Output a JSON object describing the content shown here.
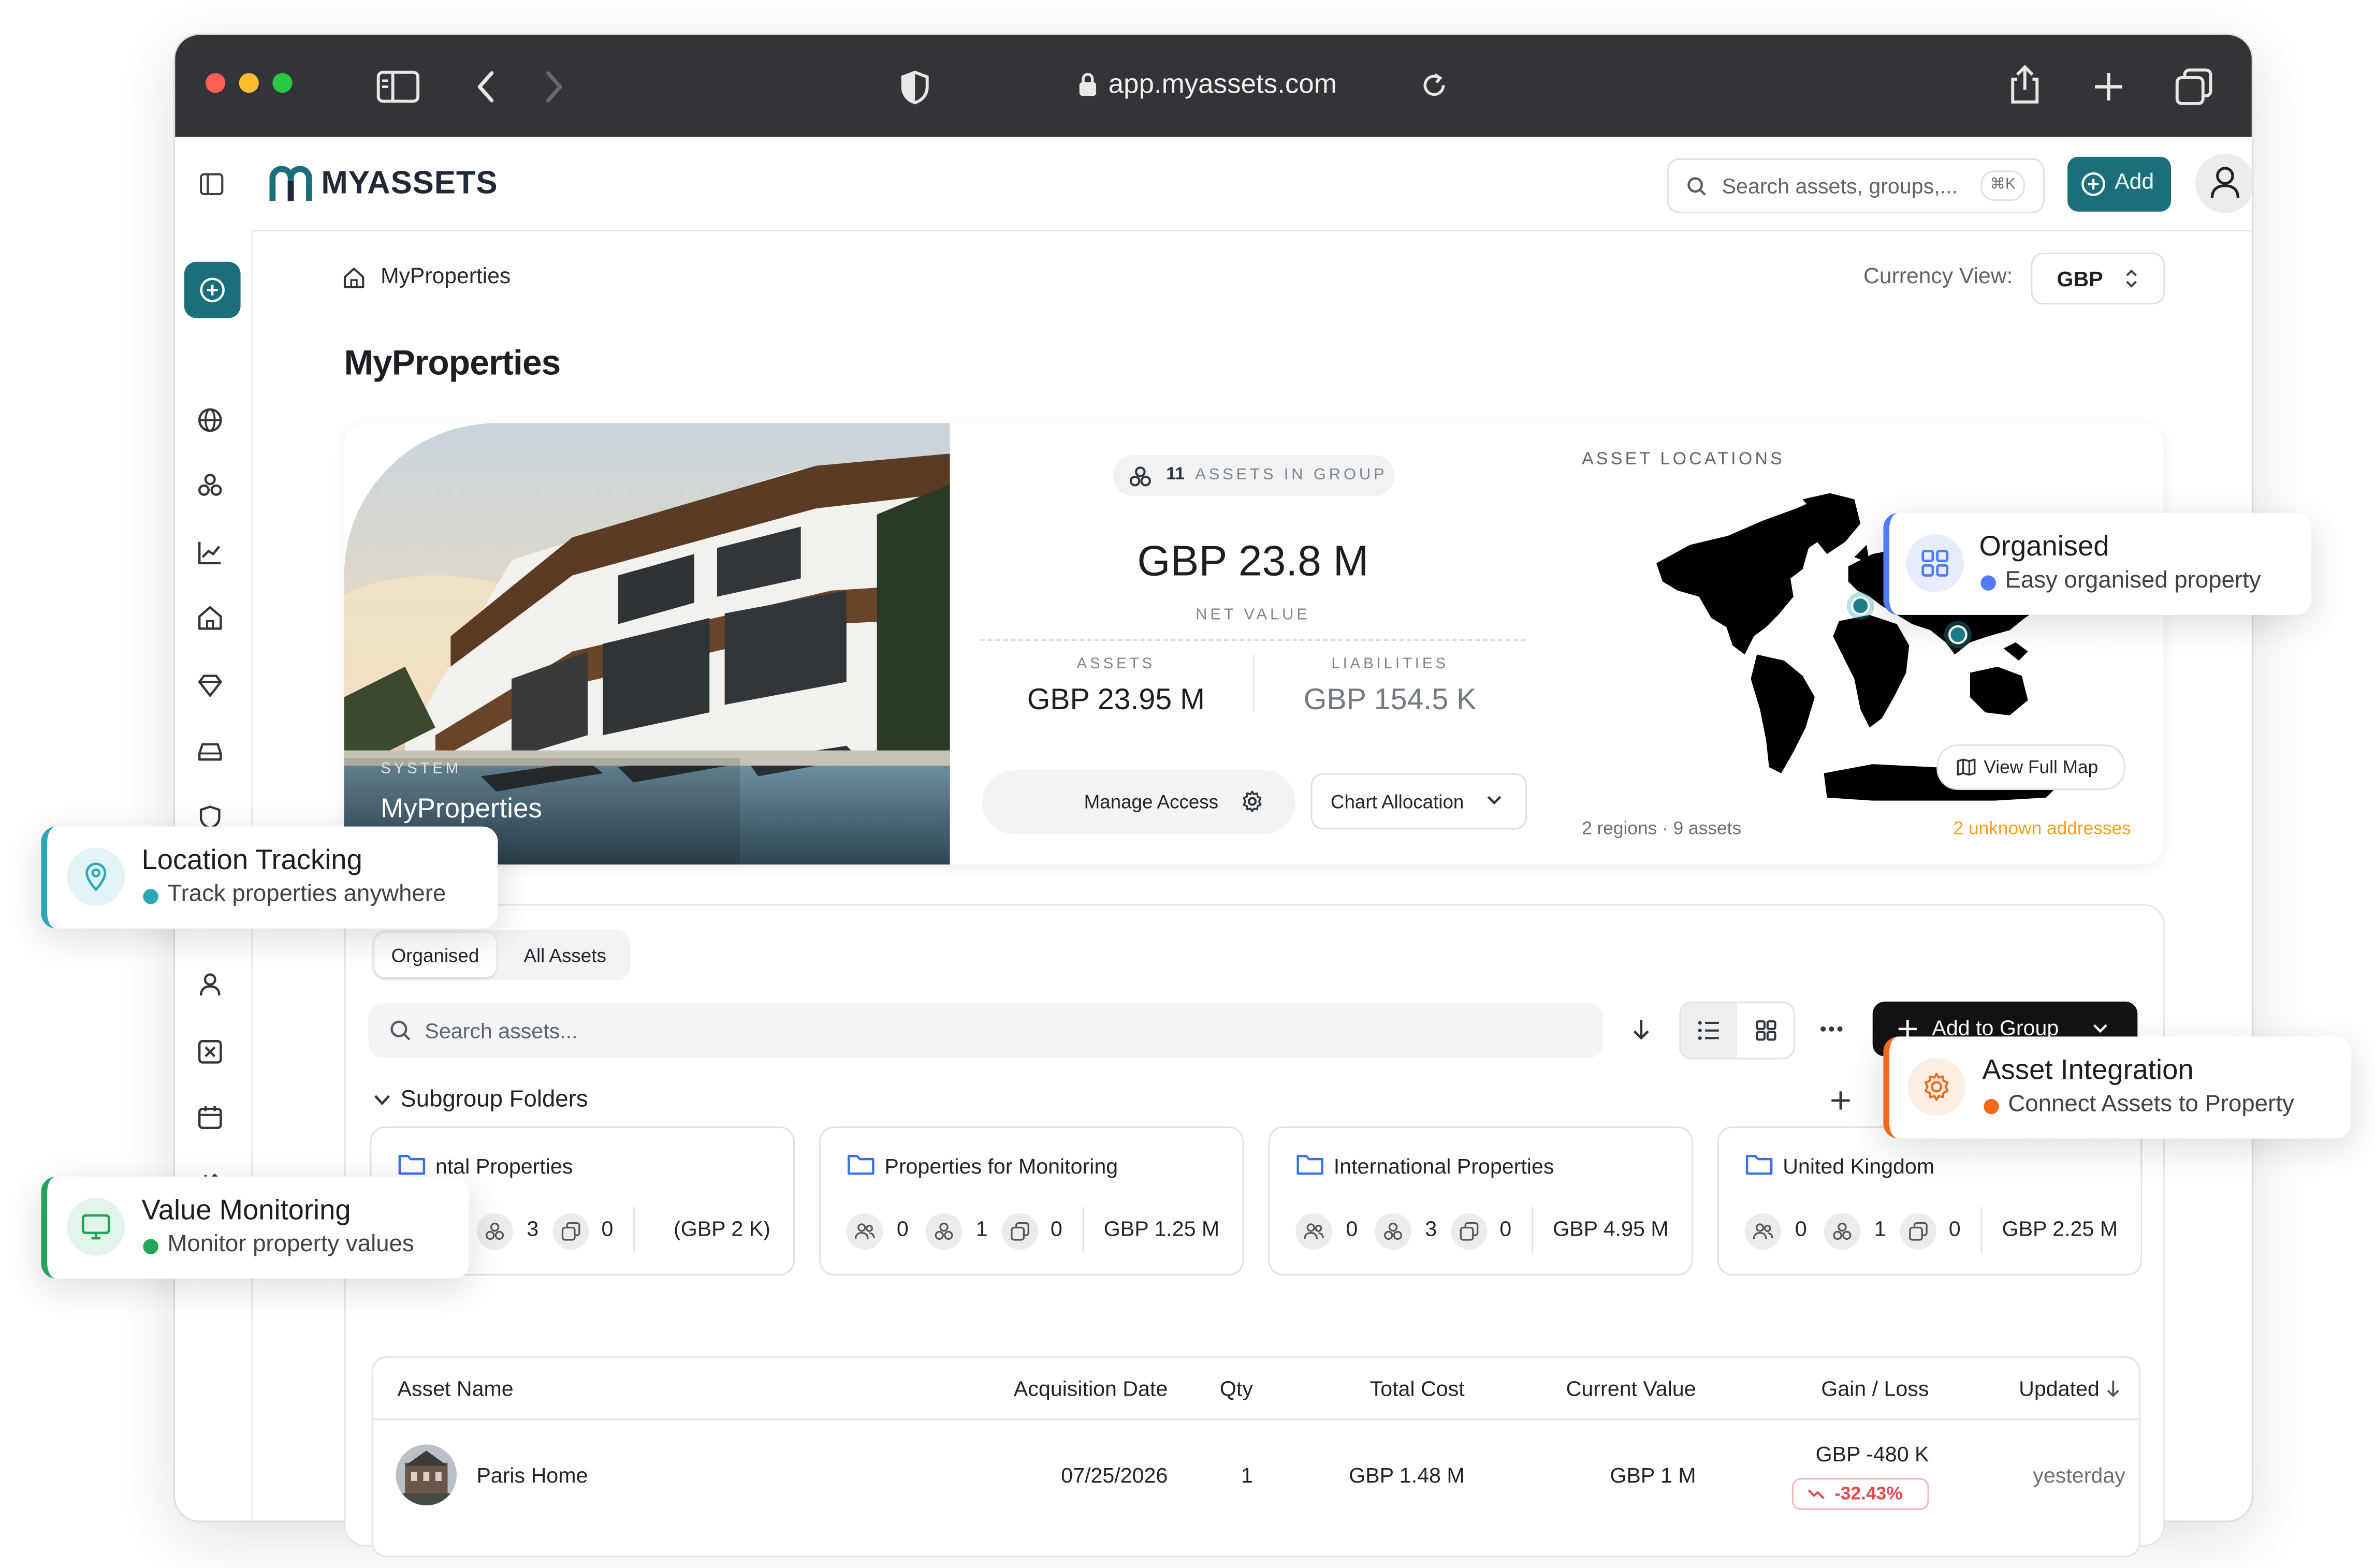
{
  "browser": {
    "url": "app.myassets.com",
    "traffic_lights": [
      "#ff5f57",
      "#febc2e",
      "#28c840"
    ]
  },
  "header": {
    "brand": "MYASSETS",
    "search_placeholder": "Search assets, groups,...",
    "search_shortcut": "⌘K",
    "add_label": "Add",
    "brand_color": "#1a6f7a"
  },
  "breadcrumb": {
    "label": "MyProperties"
  },
  "currency": {
    "label": "Currency View:",
    "value": "GBP"
  },
  "page": {
    "title": "MyProperties"
  },
  "hero": {
    "system_caption": "SYSTEM",
    "group_name": "MyProperties",
    "assets_count": "11",
    "assets_in_group": "ASSETS IN GROUP",
    "net_value": "GBP 23.8 M",
    "net_value_label": "NET VALUE",
    "assets_label": "ASSETS",
    "assets_value": "GBP 23.95 M",
    "liabilities_label": "LIABILITIES",
    "liabilities_value": "GBP 154.5 K",
    "manage_access": "Manage Access",
    "chart_allocation": "Chart Allocation"
  },
  "map": {
    "title": "ASSET LOCATIONS",
    "view_full_map": "View Full Map",
    "summary": "2 regions · 9 assets",
    "unknown": "2 unknown addresses",
    "unknown_color": "#f59f1c"
  },
  "tabs": [
    "Organised",
    "All Assets"
  ],
  "toolbar": {
    "search_placeholder": "Search assets...",
    "add_to_group": "Add to Group"
  },
  "subgroups": {
    "title": "Subgroup Folders",
    "folders": [
      {
        "name": "ntal Properties",
        "people": "",
        "assets": "3",
        "docs": "0",
        "value": "(GBP 2 K)"
      },
      {
        "name": "Properties for Monitoring",
        "people": "0",
        "assets": "1",
        "docs": "0",
        "value": "GBP 1.25 M"
      },
      {
        "name": "International Properties",
        "people": "0",
        "assets": "3",
        "docs": "0",
        "value": "GBP 4.95 M"
      },
      {
        "name": "United Kingdom",
        "people": "0",
        "assets": "1",
        "docs": "0",
        "value": "GBP 2.25 M"
      }
    ]
  },
  "table": {
    "columns": [
      "Asset Name",
      "Acquisition Date",
      "Qty",
      "Total Cost",
      "Current Value",
      "Gain / Loss",
      "Updated"
    ],
    "rows": [
      {
        "name": "Paris Home",
        "acquisition_date": "07/25/2026",
        "qty": "1",
        "total_cost": "GBP 1.48 M",
        "current_value": "GBP 1 M",
        "gain_loss": "GBP -480 K",
        "gain_loss_pct": "-32.43%",
        "updated": "yesterday"
      }
    ],
    "loss_color": "#e5484d"
  },
  "callouts": {
    "organised": {
      "title": "Organised",
      "subtitle": "Easy organised property",
      "color": "#4f7cf7"
    },
    "location": {
      "title": "Location Tracking",
      "subtitle": "Track properties anywhere",
      "color": "#2aa8b8"
    },
    "integration": {
      "title": "Asset Integration",
      "subtitle": "Connect Assets to Property",
      "color": "#f26a1b"
    },
    "monitoring": {
      "title": "Value Monitoring",
      "subtitle": "Monitor property values",
      "color": "#22a559"
    }
  }
}
